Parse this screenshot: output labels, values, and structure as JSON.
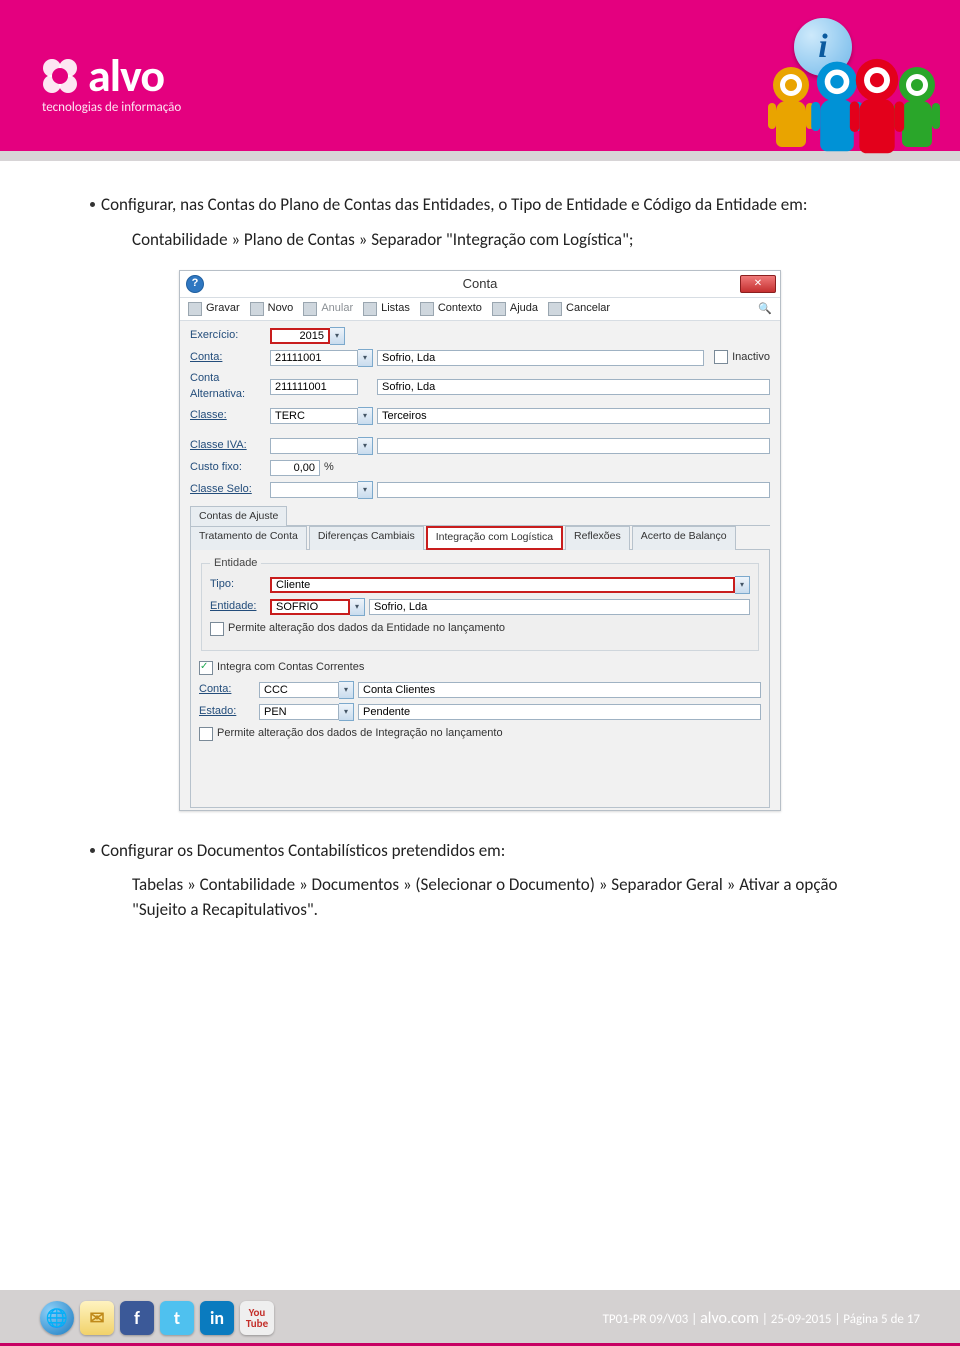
{
  "header": {
    "brand": "alvo",
    "tagline": "tecnologias de informação",
    "info_icon": "i"
  },
  "body": {
    "bullet1": "Configurar, nas Contas do Plano de Contas das Entidades, o Tipo de Entidade e Código da Entidade em:",
    "sub1": "Contabilidade » Plano de Contas » Separador \"Integração com Logística\";",
    "bullet2": "Configurar os Documentos Contabilísticos pretendidos em:",
    "sub2": "Tabelas » Contabilidade » Documentos » (Selecionar o Documento) » Separador Geral » Ativar a opção \"Sujeito a Recapitulativos\"."
  },
  "win": {
    "title": "Conta",
    "help": "?",
    "close": "✕",
    "toolbar": {
      "gravar": "Gravar",
      "novo": "Novo",
      "anular": "Anular",
      "listas": "Listas",
      "contexto": "Contexto",
      "ajuda": "Ajuda",
      "cancelar": "Cancelar",
      "search": "🔍"
    },
    "labels": {
      "exercicio": "Exercício:",
      "conta": "Conta:",
      "alt": "Conta Alternativa:",
      "classe": "Classe:",
      "iva": "Classe IVA:",
      "custo": "Custo fixo:",
      "selo": "Classe Selo:",
      "inactivo": "Inactivo",
      "pct": "%"
    },
    "values": {
      "exercicio": "2015",
      "conta_code": "21111001",
      "conta_name": "Sofrio, Lda",
      "alt_code": "211111001",
      "alt_name": "Sofrio, Lda",
      "classe_code": "TERC",
      "classe_name": "Terceiros",
      "custo": "0,00"
    },
    "tabs": {
      "ajuste": "Contas de Ajuste",
      "tratamento": "Tratamento de Conta",
      "diferencas": "Diferenças Cambiais",
      "integracao": "Integração com Logística",
      "reflexoes": "Reflexões",
      "acerto": "Acerto de Balanço"
    },
    "entidade": {
      "legend": "Entidade",
      "tipo_label": "Tipo:",
      "tipo_value": "Cliente",
      "ent_label": "Entidade:",
      "ent_code": "SOFRIO",
      "ent_name": "Sofrio, Lda",
      "perm_ent": "Permite alteração dos dados da Entidade no lançamento"
    },
    "integra": {
      "chk": "Integra com Contas Correntes",
      "conta_label": "Conta:",
      "conta_code": "CCC",
      "conta_name": "Conta Clientes",
      "estado_label": "Estado:",
      "estado_code": "PEN",
      "estado_name": "Pendente",
      "perm_int": "Permite alteração dos dados de Integração no lançamento"
    }
  },
  "footer": {
    "ref": "TP01-PR 09/V03 | ",
    "site": "alvo.com",
    "rest": " | 25-09-2015 | Página 5 de 17",
    "icons": {
      "globe": "🌐",
      "mail": "✉",
      "fb": "f",
      "tw": "t",
      "li": "in",
      "yt": "You\nTube"
    }
  }
}
